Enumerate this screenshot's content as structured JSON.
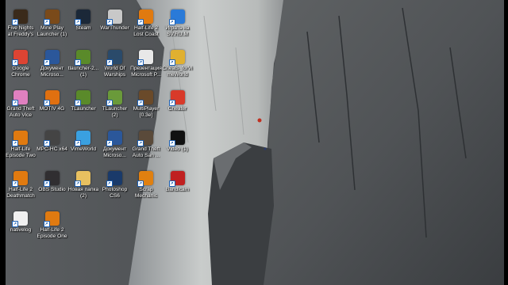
{
  "desktop": {
    "icons": [
      {
        "label": "Five Nights at Freddy's",
        "icon": "game-icon",
        "color": "#3a2a1a"
      },
      {
        "label": "Mine Play Launcher (1)",
        "icon": "minecraft-launcher-icon",
        "color": "#7a4a1a"
      },
      {
        "label": "Steam",
        "icon": "steam-icon",
        "color": "#1b2838"
      },
      {
        "label": "WarThunder",
        "icon": "warthunder-icon",
        "color": "#c8c8c8"
      },
      {
        "label": "Half-Life 2 Lost Coast",
        "icon": "half-life-icon",
        "color": "#e07a10"
      },
      {
        "label": "Играть на SV.RU.M",
        "icon": "swirl-icon",
        "color": "#2a7ad8"
      },
      {
        "label": "Google Chrome",
        "icon": "chrome-icon",
        "color": "#dd4433"
      },
      {
        "label": "Документ Microso...",
        "icon": "word-icon",
        "color": "#2b579a"
      },
      {
        "label": "tlauncher-2... (1)",
        "icon": "grass-block-icon",
        "color": "#5a8a2a"
      },
      {
        "label": "World Of Warships",
        "icon": "anchor-icon",
        "color": "#2a4a6a"
      },
      {
        "label": "Презентация Microsoft P...",
        "icon": "presentation-icon",
        "color": "#e8e8e8"
      },
      {
        "label": "Cheats_forVimeWorld",
        "icon": "zip-icon",
        "color": "#e0b030"
      },
      {
        "label": "Grand Theft Auto Vice",
        "icon": "gta-vice-icon",
        "color": "#e080c0"
      },
      {
        "label": "MOTIV 4G",
        "icon": "gear-icon",
        "color": "#e07010"
      },
      {
        "label": "TLauncher",
        "icon": "grass-block-icon",
        "color": "#5a8a2a"
      },
      {
        "label": "TLauncher (2)",
        "icon": "grass-block-icon",
        "color": "#6a9a3a"
      },
      {
        "label": "MultiPlayer [0.3e]",
        "icon": "multiplayer-icon",
        "color": "#6a4a2a"
      },
      {
        "label": "Cheater",
        "icon": "cheater-icon",
        "color": "#d83a2a"
      },
      {
        "label": "Half-Life Episode Two",
        "icon": "half-life-icon",
        "color": "#e07a10"
      },
      {
        "label": "MPC-HC x64",
        "icon": "film-icon",
        "color": "#444"
      },
      {
        "label": "VimeWorld",
        "icon": "vimeworld-icon",
        "color": "#3aa0e0"
      },
      {
        "label": "Документ Microso...",
        "icon": "word-icon",
        "color": "#2b579a"
      },
      {
        "label": "Grand Theft Auto San ...",
        "icon": "gta-san-icon",
        "color": "#5a4a3a"
      },
      {
        "label": "Video (1)",
        "icon": "video-icon",
        "color": "#111"
      },
      {
        "label": "Half-Life 2 Deathmatch",
        "icon": "half-life-icon",
        "color": "#e07a10"
      },
      {
        "label": "OBS Studio",
        "icon": "obs-icon",
        "color": "#302e31"
      },
      {
        "label": "Новая папка (2)",
        "icon": "folder-icon",
        "color": "#e8c060"
      },
      {
        "label": "Photoshop CS6",
        "icon": "photoshop-icon",
        "color": "#1a3a6a"
      },
      {
        "label": "Scrap Mechanic",
        "icon": "scrap-icon",
        "color": "#e08010"
      },
      {
        "label": "Bandicam",
        "icon": "bandicam-icon",
        "color": "#c02020"
      },
      {
        "label": "nativelog",
        "icon": "text-file-icon",
        "color": "#f0f0f0"
      },
      {
        "label": "Half-Life 2 Episode One",
        "icon": "half-life-icon",
        "color": "#e07a10"
      }
    ]
  }
}
